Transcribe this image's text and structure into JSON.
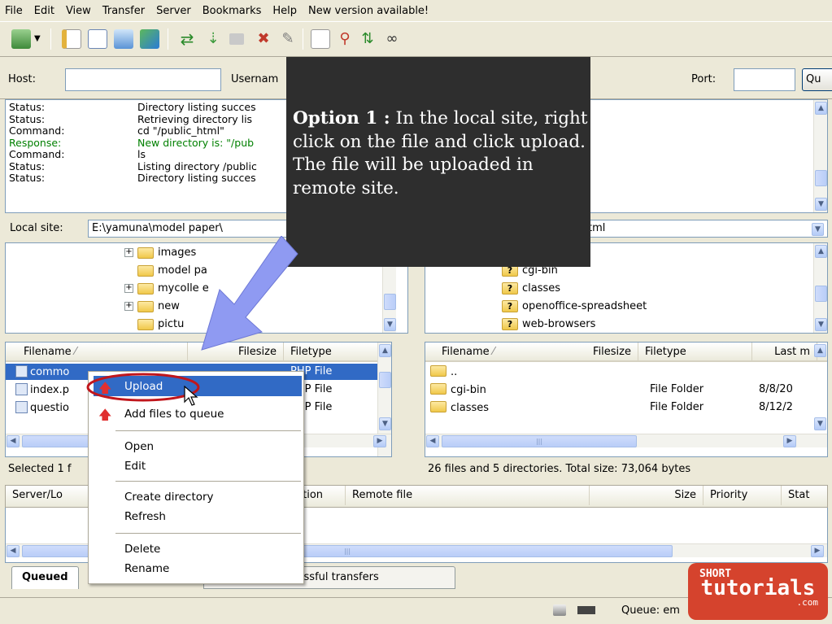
{
  "menu": [
    "File",
    "Edit",
    "View",
    "Transfer",
    "Server",
    "Bookmarks",
    "Help",
    "New version available!"
  ],
  "quickconnect": {
    "host_label": "Host:",
    "username_label": "Usernam",
    "port_label": "Port:",
    "connect_label": "Qu",
    "host_value": "",
    "port_value": ""
  },
  "log": [
    {
      "type": "Status:",
      "msg": "Directory listing succes"
    },
    {
      "type": "Status:",
      "msg": "Retrieving directory lis"
    },
    {
      "type": "Command:",
      "msg": "cd \"/public_html\""
    },
    {
      "type": "Response:",
      "msg": "New directory is: \"/pub"
    },
    {
      "type": "Command:",
      "msg": "ls"
    },
    {
      "type": "Status:",
      "msg": "Listing directory /public"
    },
    {
      "type": "Status:",
      "msg": "Directory listing succes"
    }
  ],
  "local": {
    "site_label": "Local site:",
    "path": "E:\\yamuna\\model paper\\",
    "tree": [
      "images",
      "model pa",
      "mycolle e",
      "new",
      "pictu"
    ],
    "headers": {
      "filename": "Filename",
      "filesize": "Filesize",
      "filetype": "Filetype"
    },
    "files": [
      {
        "name": "commo",
        "size": "",
        "type": "PHP File"
      },
      {
        "name": "index.p",
        "size": "",
        "type": "PHP File"
      },
      {
        "name": "questio",
        "size": "",
        "type": "PHP File"
      }
    ],
    "status": "Selected 1 f"
  },
  "remote": {
    "path": "tml",
    "tree": [
      "cgi-bin",
      "classes",
      "openoffice-spreadsheet",
      "web-browsers"
    ],
    "headers": {
      "filename": "Filename",
      "filesize": "Filesize",
      "filetype": "Filetype",
      "lastmod": "Last m"
    },
    "files": [
      {
        "name": "..",
        "type": "",
        "date": ""
      },
      {
        "name": "cgi-bin",
        "type": "File Folder",
        "date": "8/8/20"
      },
      {
        "name": "classes",
        "type": "File Folder",
        "date": "8/12/2"
      }
    ],
    "status": "26 files and 5 directories. Total size: 73,064 bytes"
  },
  "queue": {
    "headers": {
      "server": "Server/Lo",
      "direction": "ction",
      "remote": "Remote file",
      "size": "Size",
      "priority": "Priority",
      "status": "Stat"
    },
    "tabs": {
      "queued": "Queued",
      "successful": "uccessful transfers"
    },
    "status": "Queue: em"
  },
  "context_menu": {
    "upload": "Upload",
    "add_queue": "Add files to queue",
    "open": "Open",
    "edit": "Edit",
    "create_dir": "Create directory",
    "refresh": "Refresh",
    "delete": "Delete",
    "rename": "Rename"
  },
  "overlay": {
    "bold": "Option 1 :",
    "text": " In the local site, right click on the file  and click upload. The file will be uploaded in remote site."
  },
  "brand": {
    "line1": "SHORT",
    "line2": "tutorials",
    "line3": ".com"
  },
  "colors": {
    "selection": "#316ac5",
    "overlay_bg": "#2e2e2e",
    "brand": "#d5432d",
    "arrow": "#8f9af2",
    "highlight": "#c0161c"
  }
}
